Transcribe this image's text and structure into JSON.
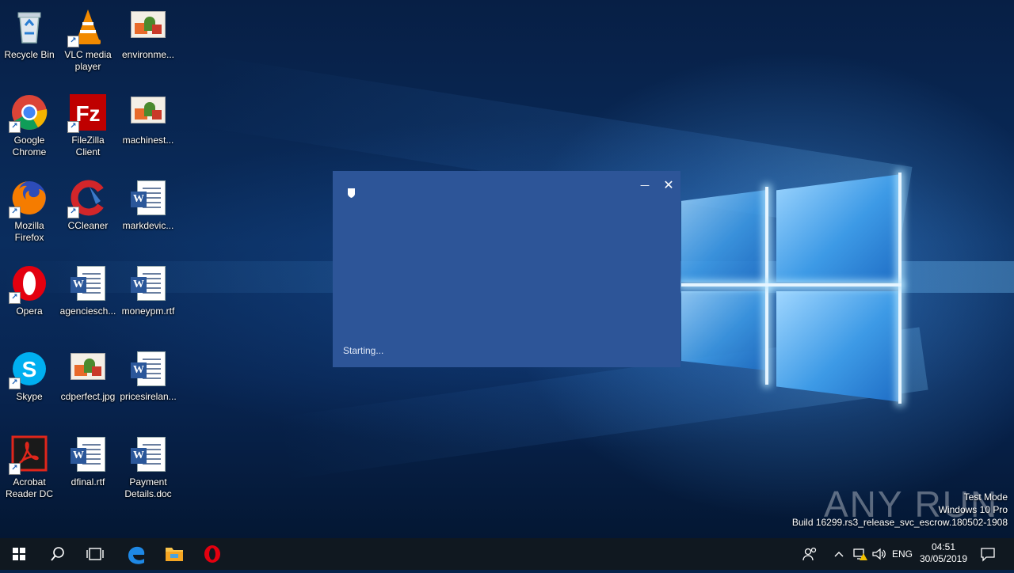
{
  "desktop": {
    "icons": [
      {
        "label": "Recycle Bin",
        "icon": "recycle-bin-icon"
      },
      {
        "label": "VLC media player",
        "icon": "vlc-icon"
      },
      {
        "label": "environme...",
        "icon": "image-file-icon"
      },
      {
        "label": "Google Chrome",
        "icon": "chrome-icon"
      },
      {
        "label": "FileZilla Client",
        "icon": "filezilla-icon"
      },
      {
        "label": "machinest...",
        "icon": "image-file-icon"
      },
      {
        "label": "Mozilla Firefox",
        "icon": "firefox-icon"
      },
      {
        "label": "CCleaner",
        "icon": "ccleaner-icon"
      },
      {
        "label": "markdevic...",
        "icon": "word-document-icon"
      },
      {
        "label": "Opera",
        "icon": "opera-icon"
      },
      {
        "label": "agenciesch...",
        "icon": "word-document-icon"
      },
      {
        "label": "moneypm.rtf",
        "icon": "word-document-icon"
      },
      {
        "label": "Skype",
        "icon": "skype-icon"
      },
      {
        "label": "cdperfect.jpg",
        "icon": "image-file-icon"
      },
      {
        "label": "pricesirelan...",
        "icon": "word-document-icon"
      },
      {
        "label": "Acrobat Reader DC",
        "icon": "acrobat-icon"
      },
      {
        "label": "dfinal.rtf",
        "icon": "word-document-icon"
      },
      {
        "label": "Payment Details.doc",
        "icon": "word-document-icon"
      }
    ]
  },
  "dialog": {
    "status": "Starting...",
    "minimize_glyph": "—",
    "close_glyph": "✕",
    "background": "#2d5598"
  },
  "watermark": {
    "brand": "ANY RUN",
    "line1": "Test Mode",
    "line2": "Windows 10 Pro",
    "line3": "Build 16299.rs3_release_svc_escrow.180502-1908"
  },
  "taskbar": {
    "pinned": [
      "start-icon",
      "search-icon",
      "task-view-icon",
      "edge-icon",
      "file-explorer-icon",
      "opera-icon"
    ],
    "language": "ENG",
    "time": "04:51",
    "date": "30/05/2019"
  },
  "colors": {
    "taskbar": "#101820",
    "dialog": "#2d5598",
    "accent": "#0078d7"
  }
}
